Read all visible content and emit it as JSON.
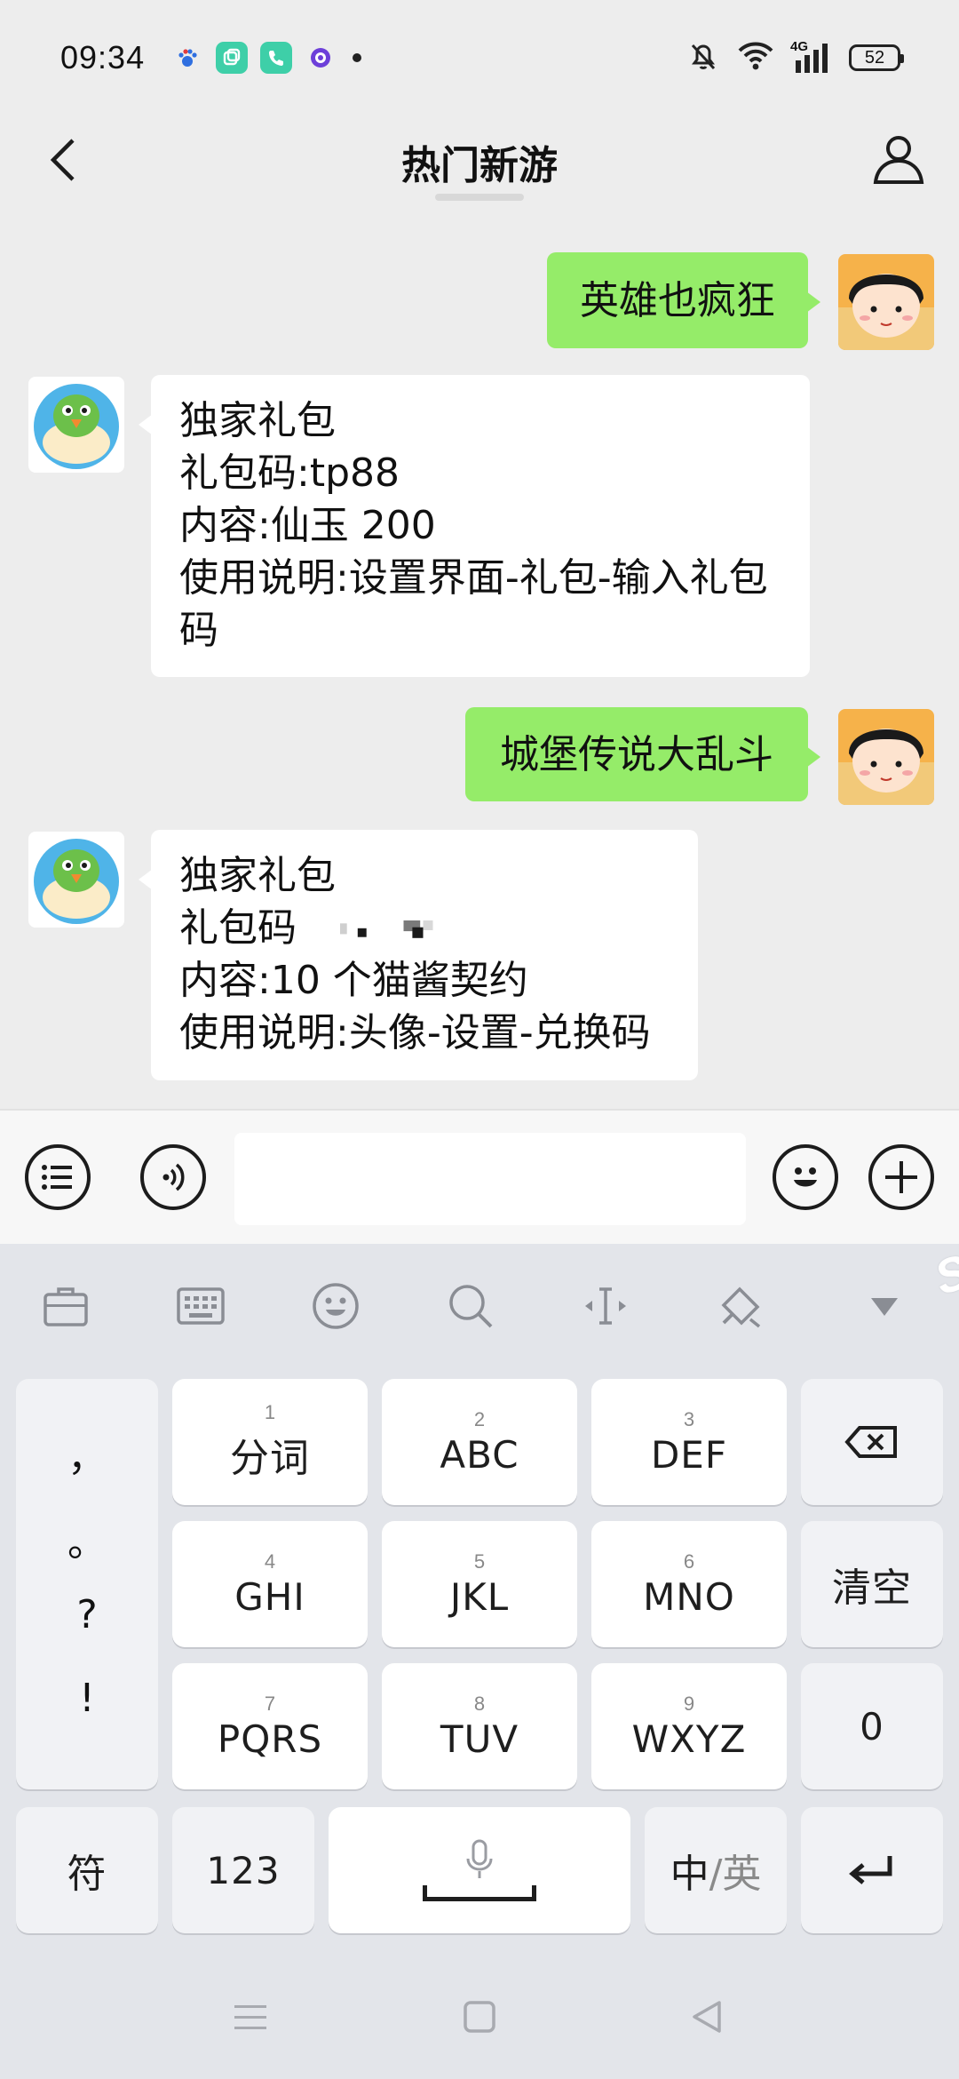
{
  "status_bar": {
    "time": "09:34",
    "network": "4G",
    "battery": "52",
    "notification_icons": [
      "baidu-paw-icon",
      "multitask-app-icon",
      "phone-app-icon",
      "assistant-app-icon"
    ]
  },
  "header": {
    "title": "热门新游"
  },
  "messages": [
    {
      "sender": "me",
      "text": "英雄也疯狂"
    },
    {
      "sender": "bot",
      "lines": [
        "独家礼包",
        "礼包码:tp88",
        "内容:仙玉 200",
        "使用说明:设置界面-礼包-输入礼包",
        "码"
      ]
    },
    {
      "sender": "me",
      "text": "城堡传说大乱斗"
    },
    {
      "sender": "bot",
      "lines": [
        "独家礼包",
        "礼包码",
        "内容:10 个猫酱契约",
        "使用说明:头像-设置-兑换码"
      ]
    }
  ],
  "input_bar": {
    "value": "",
    "placeholder": ""
  },
  "keyboard": {
    "punctuation": [
      "，",
      "。",
      "?",
      "!"
    ],
    "keys": [
      {
        "num": "1",
        "label": "分词"
      },
      {
        "num": "2",
        "label": "ABC"
      },
      {
        "num": "3",
        "label": "DEF"
      },
      {
        "num": "4",
        "label": "GHI"
      },
      {
        "num": "5",
        "label": "JKL"
      },
      {
        "num": "6",
        "label": "MNO"
      },
      {
        "num": "7",
        "label": "PQRS"
      },
      {
        "num": "8",
        "label": "TUV"
      },
      {
        "num": "9",
        "label": "WXYZ"
      }
    ],
    "clear": "清空",
    "zero": "0",
    "symbol": "符",
    "numeric": "123",
    "lang_zh": "中",
    "lang_sep": "/",
    "lang_en": "英"
  },
  "colors": {
    "my_bubble": "#95ec69",
    "bot_bubble": "#ffffff",
    "chat_background": "#ededed",
    "keyboard_background": "#e3e5ea"
  }
}
